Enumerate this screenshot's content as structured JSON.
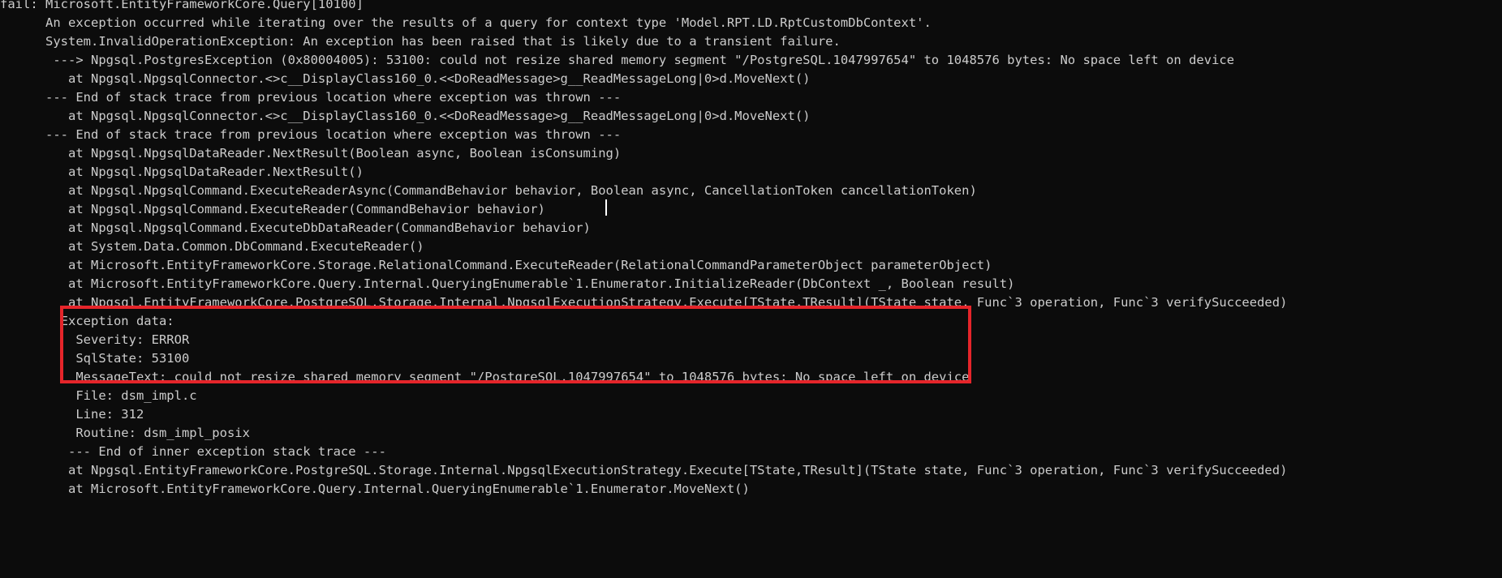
{
  "console": {
    "colors": {
      "background": "#0c0c0c",
      "text": "#cccccc",
      "highlight_border": "#e5252a"
    },
    "lines": [
      "fail: Microsoft.EntityFrameworkCore.Query[10100]",
      "      An exception occurred while iterating over the results of a query for context type 'Model.RPT.LD.RptCustomDbContext'.",
      "      System.InvalidOperationException: An exception has been raised that is likely due to a transient failure.",
      "       ---> Npgsql.PostgresException (0x80004005): 53100: could not resize shared memory segment \"/PostgreSQL.1047997654\" to 1048576 bytes: No space left on device",
      "         at Npgsql.NpgsqlConnector.<>c__DisplayClass160_0.<<DoReadMessage>g__ReadMessageLong|0>d.MoveNext()",
      "      --- End of stack trace from previous location where exception was thrown ---",
      "         at Npgsql.NpgsqlConnector.<>c__DisplayClass160_0.<<DoReadMessage>g__ReadMessageLong|0>d.MoveNext()",
      "      --- End of stack trace from previous location where exception was thrown ---",
      "         at Npgsql.NpgsqlDataReader.NextResult(Boolean async, Boolean isConsuming)",
      "         at Npgsql.NpgsqlDataReader.NextResult()",
      "         at Npgsql.NpgsqlCommand.ExecuteReaderAsync(CommandBehavior behavior, Boolean async, CancellationToken cancellationToken)",
      "         at Npgsql.NpgsqlCommand.ExecuteReader(CommandBehavior behavior)",
      "         at Npgsql.NpgsqlCommand.ExecuteDbDataReader(CommandBehavior behavior)",
      "         at System.Data.Common.DbCommand.ExecuteReader()",
      "         at Microsoft.EntityFrameworkCore.Storage.RelationalCommand.ExecuteReader(RelationalCommandParameterObject parameterObject)",
      "         at Microsoft.EntityFrameworkCore.Query.Internal.QueryingEnumerable`1.Enumerator.InitializeReader(DbContext _, Boolean result)",
      "         at Npgsql.EntityFrameworkCore.PostgreSQL.Storage.Internal.NpgsqlExecutionStrategy.Execute[TState,TResult](TState state, Func`3 operation, Func`3 verifySucceeded)",
      "        Exception data:",
      "          Severity: ERROR",
      "          SqlState: 53100",
      "          MessageText: could not resize shared memory segment \"/PostgreSQL.1047997654\" to 1048576 bytes: No space left on device",
      "          File: dsm_impl.c",
      "          Line: 312",
      "          Routine: dsm_impl_posix",
      "         --- End of inner exception stack trace ---",
      "         at Npgsql.EntityFrameworkCore.PostgreSQL.Storage.Internal.NpgsqlExecutionStrategy.Execute[TState,TResult](TState state, Func`3 operation, Func`3 verifySucceeded)",
      "         at Microsoft.EntityFrameworkCore.Query.Internal.QueryingEnumerable`1.Enumerator.MoveNext()"
    ]
  }
}
